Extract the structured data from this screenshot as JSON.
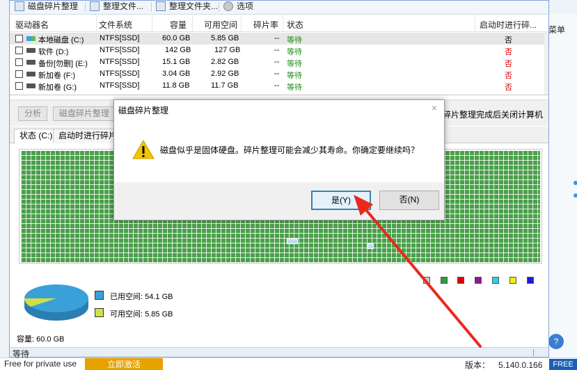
{
  "toolbar": {
    "items": [
      {
        "label": "磁盘碎片整理"
      },
      {
        "label": "整理文件..."
      },
      {
        "label": "整理文件夹..."
      },
      {
        "label": "选项"
      }
    ]
  },
  "table": {
    "headers": [
      "驱动器名",
      "文件系统",
      "容量",
      "可用空间",
      "碎片率",
      "状态",
      "启动时进行碎..."
    ],
    "rows": [
      {
        "name": "本地磁盘 (C:)",
        "fs": "NTFS[SSD]",
        "capacity": "60.0 GB",
        "free": "5.85 GB",
        "frag": "--",
        "status": "等待",
        "boot": "否"
      },
      {
        "name": "软件 (D:)",
        "fs": "NTFS[SSD]",
        "capacity": "142 GB",
        "free": "127 GB",
        "frag": "--",
        "status": "等待",
        "boot": "否"
      },
      {
        "name": "备份[勿删] (E:)",
        "fs": "NTFS[SSD]",
        "capacity": "15.1 GB",
        "free": "2.82 GB",
        "frag": "--",
        "status": "等待",
        "boot": "否"
      },
      {
        "name": "新加卷 (F:)",
        "fs": "NTFS[SSD]",
        "capacity": "3.04 GB",
        "free": "2.92 GB",
        "frag": "--",
        "status": "等待",
        "boot": "否"
      },
      {
        "name": "新加卷 (G:)",
        "fs": "NTFS[SSD]",
        "capacity": "11.8 GB",
        "free": "11.7 GB",
        "frag": "--",
        "status": "等待",
        "boot": "否"
      }
    ]
  },
  "actions": {
    "analyze": "分析",
    "defrag": "磁盘碎片整理",
    "shutdown_option": "碎片整理完成后关闭计算机"
  },
  "tabs": {
    "status": "状态 (C:)",
    "boot": "启动时进行碎片"
  },
  "usage": {
    "used_label": "已用空间: 54.1 GB",
    "free_label": "可用空间: 5.85 GB",
    "capacity_label": "容量: 60.0 GB",
    "used_color": "#3aa0d8",
    "free_color": "#cfe04a"
  },
  "legend_colors": [
    "#c8c8c8",
    "#2e9c3a",
    "#e00000",
    "#8a1a8a",
    "#2fd0e0",
    "#f0f000",
    "#1a1ad8"
  ],
  "window_status": "等待",
  "dialog": {
    "title": "磁盘碎片整理",
    "message": "磁盘似乎是固体硬盘。碎片整理可能会减少其寿命。你确定要继续吗？",
    "yes": "是(Y)",
    "no": "否(N)",
    "close": "×"
  },
  "host": {
    "menu_text": "菜单",
    "free_text": "Free for private use",
    "upgrade": "立即激活",
    "version_label": "版本：",
    "version": "5.140.0.166",
    "free_badge": "FREE"
  }
}
